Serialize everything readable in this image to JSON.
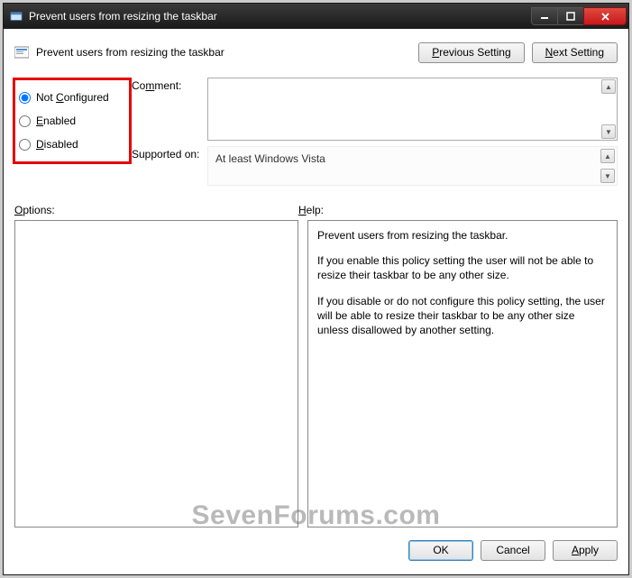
{
  "window": {
    "title": "Prevent users from resizing the taskbar"
  },
  "header": {
    "policy_name": "Prevent users from resizing the taskbar",
    "prev_btn_pre": "",
    "prev_btn_u": "P",
    "prev_btn_post": "revious Setting",
    "next_btn_pre": "",
    "next_btn_u": "N",
    "next_btn_post": "ext Setting"
  },
  "radios": {
    "not_configured_pre": "Not ",
    "not_configured_u": "C",
    "not_configured_post": "onfigured",
    "enabled_u": "E",
    "enabled_post": "nabled",
    "disabled_u": "D",
    "disabled_post": "isabled",
    "selected": "not_configured"
  },
  "fields": {
    "comment_label_pre": "Co",
    "comment_label_u": "m",
    "comment_label_post": "ment:",
    "comment_value": "",
    "supported_label": "Supported on:",
    "supported_value": "At least Windows Vista"
  },
  "lower": {
    "options_label_u": "O",
    "options_label_post": "ptions:",
    "help_label_u": "H",
    "help_label_post": "elp:",
    "options_content": "",
    "help_p1": "Prevent users from resizing the taskbar.",
    "help_p2": "If you enable this policy setting the user will not be able to resize their taskbar to be any other size.",
    "help_p3": "If you disable or do not configure this policy setting, the user will be able to resize their taskbar to be any other size unless disallowed by another setting."
  },
  "footer": {
    "ok": "OK",
    "cancel": "Cancel",
    "apply_u": "A",
    "apply_post": "pply"
  },
  "watermark": "SevenForums.com"
}
